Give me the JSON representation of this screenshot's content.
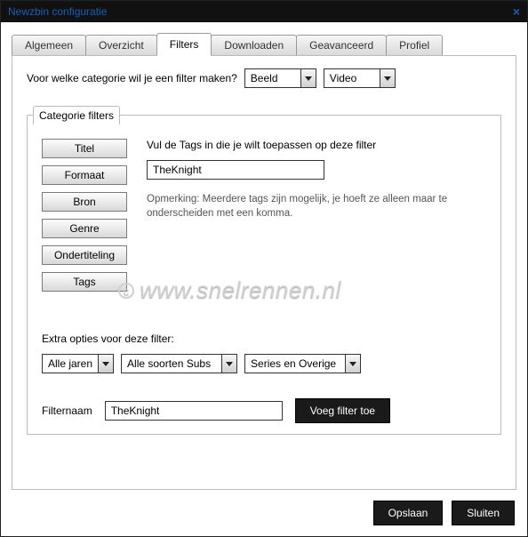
{
  "window": {
    "title": "Newzbin configuratie",
    "close_label": "×"
  },
  "tabs": [
    "Algemeen",
    "Overzicht",
    "Filters",
    "Downloaden",
    "Geavanceerd",
    "Profiel"
  ],
  "active_tab_index": 2,
  "filter_question": "Voor welke categorie wil je een filter maken?",
  "category_select": {
    "value": "Beeld"
  },
  "subcategory_select": {
    "value": "Video"
  },
  "fieldset": {
    "legend": "Categorie filters",
    "side_buttons": [
      "Titel",
      "Formaat",
      "Bron",
      "Genre",
      "Ondertiteling",
      "Tags"
    ],
    "tags_label": "Vul de Tags in die je wilt toepassen op deze filter",
    "tags_value": "TheKnight",
    "note": "Opmerking: Meerdere tags zijn mogelijk, je hoeft ze alleen maar te onderscheiden met een komma.",
    "extras_label": "Extra opties voor deze filter:",
    "year_select": {
      "value": "Alle jaren"
    },
    "subs_select": {
      "value": "Alle soorten Subs"
    },
    "series_select": {
      "value": "Series en Overige"
    },
    "filtername_label": "Filternaam",
    "filtername_value": "TheKnight",
    "add_button": "Voeg filter toe"
  },
  "watermark": "www.snelrennen.nl",
  "footer": {
    "save": "Opslaan",
    "close": "Sluiten"
  }
}
